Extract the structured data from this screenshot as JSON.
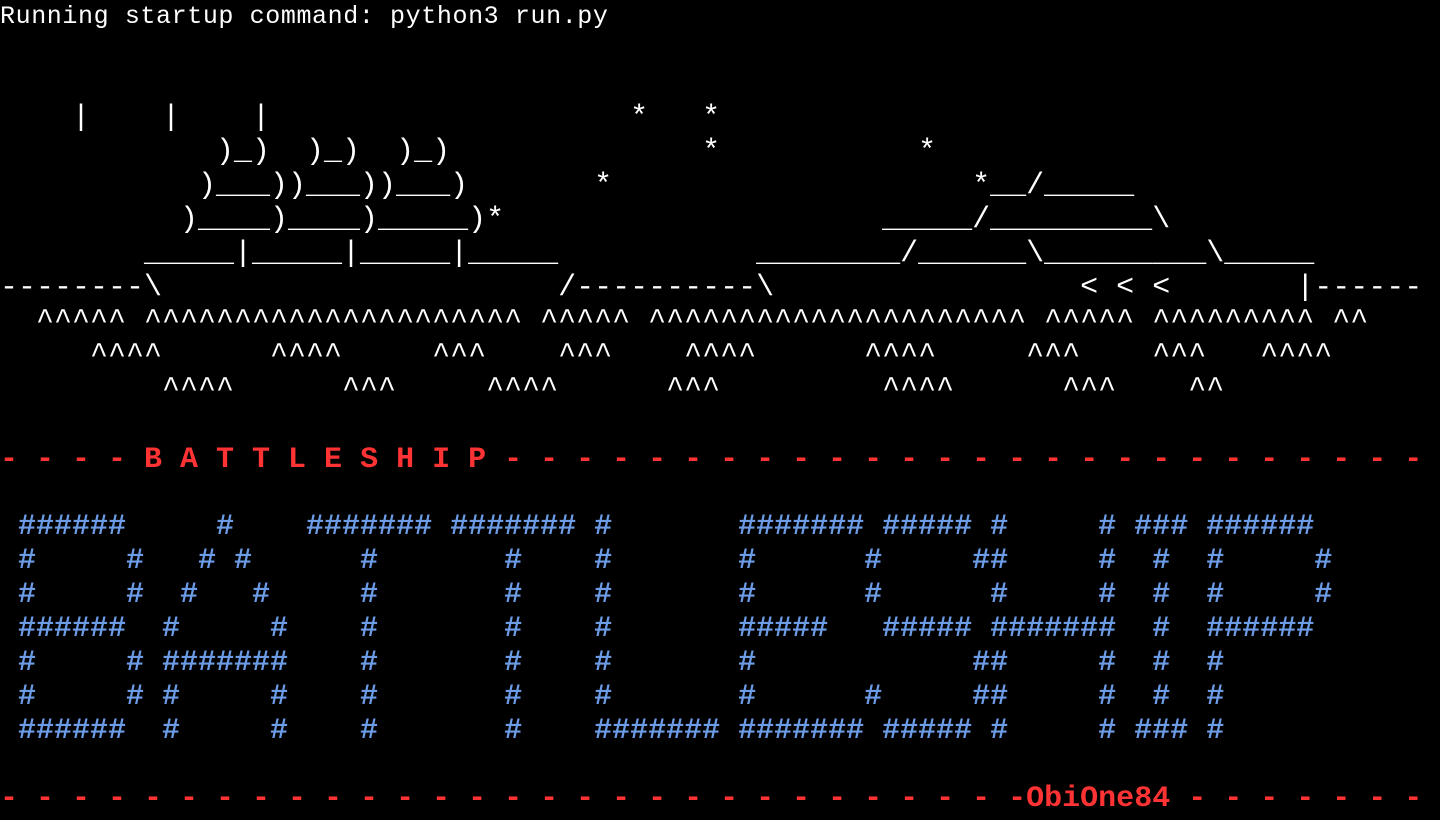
{
  "terminal": {
    "startup_line": "Running startup command: python3 run.py",
    "art_lines": [
      "    |    |    |                    *   *",
      "            )_)  )_)  )_)              *           *",
      "           )___))___))___)       *                    *__/_____",
      "          )____)____)_____)*                     _____/_________\\",
      "        _____|_____|_____|_____           ________/______\\_________\\_____",
      "--------\\                      /----------\\                 < < <       |------",
      "  ^^^^^ ^^^^^^^^^^^^^^^^^^^^^ ^^^^^ ^^^^^^^^^^^^^^^^^^^^^ ^^^^^ ^^^^^^^^^ ^^",
      "     ^^^^      ^^^^     ^^^    ^^^    ^^^^      ^^^^     ^^^    ^^^   ^^^^",
      "         ^^^^      ^^^     ^^^^      ^^^         ^^^^      ^^^    ^^"
    ],
    "divider_top": {
      "left": "- - - - ",
      "title": "B A T T L E S H I P",
      "right": " - - - - - - - - - - - - - - - - - - - - - - - - - - - - - -"
    },
    "banner_lines": [
      " ######     #    ####### ####### #       ####### ##### #     # ### ######",
      " #     #   # #      #       #    #       #      #     ##     #  #  #     #",
      " #     #  #   #     #       #    #       #      #      #     #  #  #     #",
      " ######  #     #    #       #    #       #####   ##### #######  #  ######",
      " #     # #######    #       #    #       #            ##     #  #  #",
      " #     # #     #    #       #    #       #      #     ##     #  #  #",
      " ######  #     #    #       #    ####### ####### ##### #     # ### #"
    ],
    "divider_bottom": {
      "left": "- - - - - - - - - - - - - - - - - - - - - - - - - - - - -",
      "author": "ObiOne84",
      "right": " - - - - - - -"
    },
    "colors": {
      "background": "#000000",
      "text": "#ffffff",
      "divider": "#ff3333",
      "banner": "#6c9ce6"
    }
  }
}
